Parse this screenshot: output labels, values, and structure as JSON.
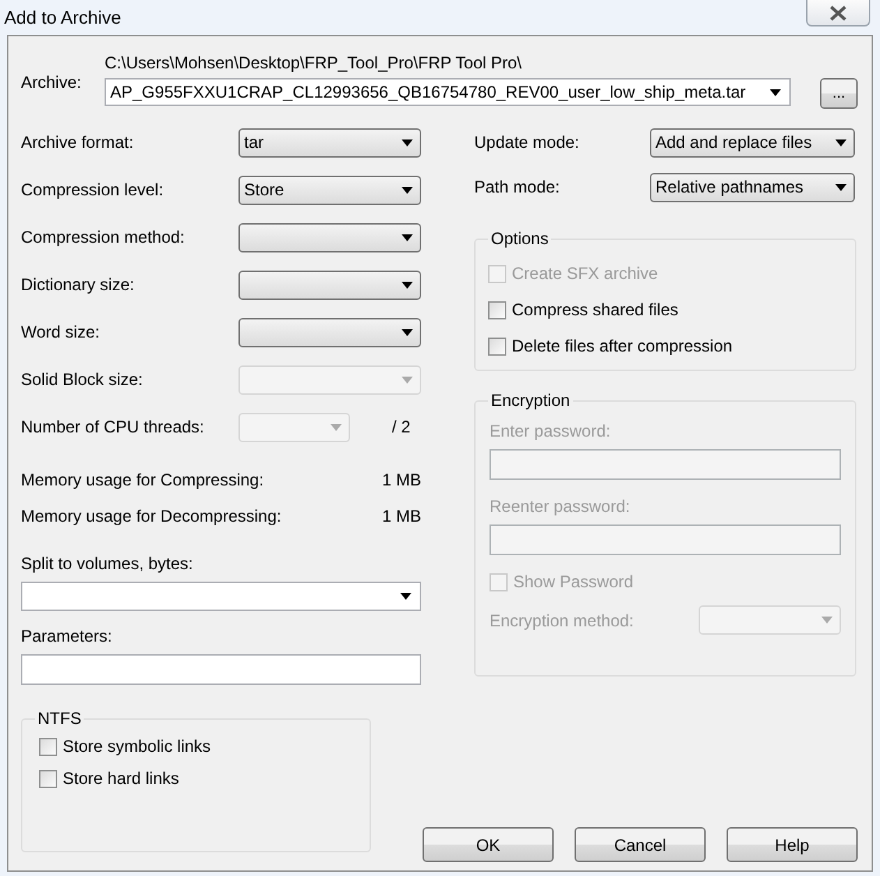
{
  "window": {
    "title": "Add to Archive"
  },
  "archive": {
    "label": "Archive:",
    "folder": "C:\\Users\\Mohsen\\Desktop\\FRP_Tool_Pro\\FRP Tool Pro\\",
    "value": "AP_G955FXXU1CRAP_CL12993656_QB16754780_REV00_user_low_ship_meta.tar",
    "browse": "..."
  },
  "settings": [
    {
      "label": "Archive format:",
      "value": "tar",
      "disabled": false
    },
    {
      "label": "Compression level:",
      "value": "Store",
      "disabled": false
    },
    {
      "label": "Compression method:",
      "disabled": false
    },
    {
      "label": "Dictionary size:",
      "disabled": false
    },
    {
      "label": "Word size:",
      "disabled": false
    },
    {
      "label": "Solid Block size:",
      "disabled": true
    },
    {
      "label": "Number of CPU threads:",
      "disabled": true,
      "suffix": "/ 2"
    }
  ],
  "memory": [
    {
      "label": "Memory usage for Compressing:",
      "value": "1 MB"
    },
    {
      "label": "Memory usage for Decompressing:",
      "value": "1 MB"
    }
  ],
  "split": {
    "label": "Split to volumes, bytes:"
  },
  "parameters": {
    "label": "Parameters:"
  },
  "ntfs": {
    "title": "NTFS",
    "items": [
      {
        "label": "Store symbolic links",
        "checked": false,
        "disabled": false
      },
      {
        "label": "Store hard links",
        "checked": false,
        "disabled": false
      }
    ]
  },
  "modes": [
    {
      "label": "Update mode:",
      "value": "Add and replace files"
    },
    {
      "label": "Path mode:",
      "value": "Relative pathnames"
    }
  ],
  "options": {
    "title": "Options",
    "items": [
      {
        "label": "Create SFX archive",
        "checked": false,
        "disabled": true
      },
      {
        "label": "Compress shared files",
        "checked": false,
        "disabled": false
      },
      {
        "label": "Delete files after compression",
        "checked": false,
        "disabled": false
      }
    ]
  },
  "encryption": {
    "title": "Encryption",
    "disabled": true,
    "password_label": "Enter password:",
    "reenter_label": "Reenter password:",
    "show_password": {
      "label": "Show Password",
      "checked": false
    },
    "method_label": "Encryption method:"
  },
  "buttons": [
    "OK",
    "Cancel",
    "Help"
  ]
}
